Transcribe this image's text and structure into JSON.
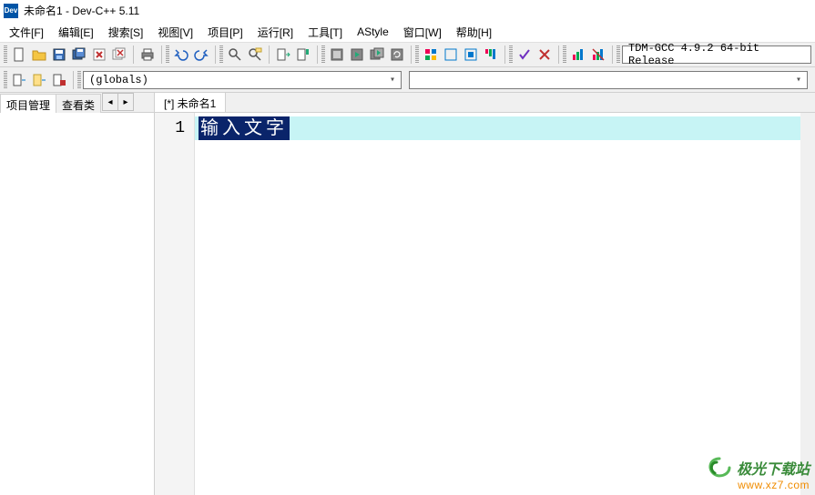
{
  "window": {
    "app_icon_text": "Dev",
    "title": "未命名1 - Dev-C++ 5.11"
  },
  "menubar": {
    "items": [
      {
        "label": "文件[F]"
      },
      {
        "label": "编辑[E]"
      },
      {
        "label": "搜索[S]"
      },
      {
        "label": "视图[V]"
      },
      {
        "label": "项目[P]"
      },
      {
        "label": "运行[R]"
      },
      {
        "label": "工具[T]"
      },
      {
        "label": "AStyle"
      },
      {
        "label": "窗口[W]"
      },
      {
        "label": "帮助[H]"
      }
    ]
  },
  "toolbar": {
    "compiler_text": "TDM-GCC 4.9.2 64-bit Release"
  },
  "toolbar2": {
    "scope_dropdown": "(globals)",
    "member_dropdown": ""
  },
  "side_panel": {
    "tabs": [
      {
        "label": "项目管理"
      },
      {
        "label": "查看类"
      }
    ],
    "nav_left": "◂",
    "nav_right": "▸"
  },
  "editor": {
    "file_tab": "[*] 未命名1",
    "line_number": "1",
    "selected_text": "输入文字"
  },
  "watermark": {
    "brand": "极光下载站",
    "url": "www.xz7.com"
  }
}
